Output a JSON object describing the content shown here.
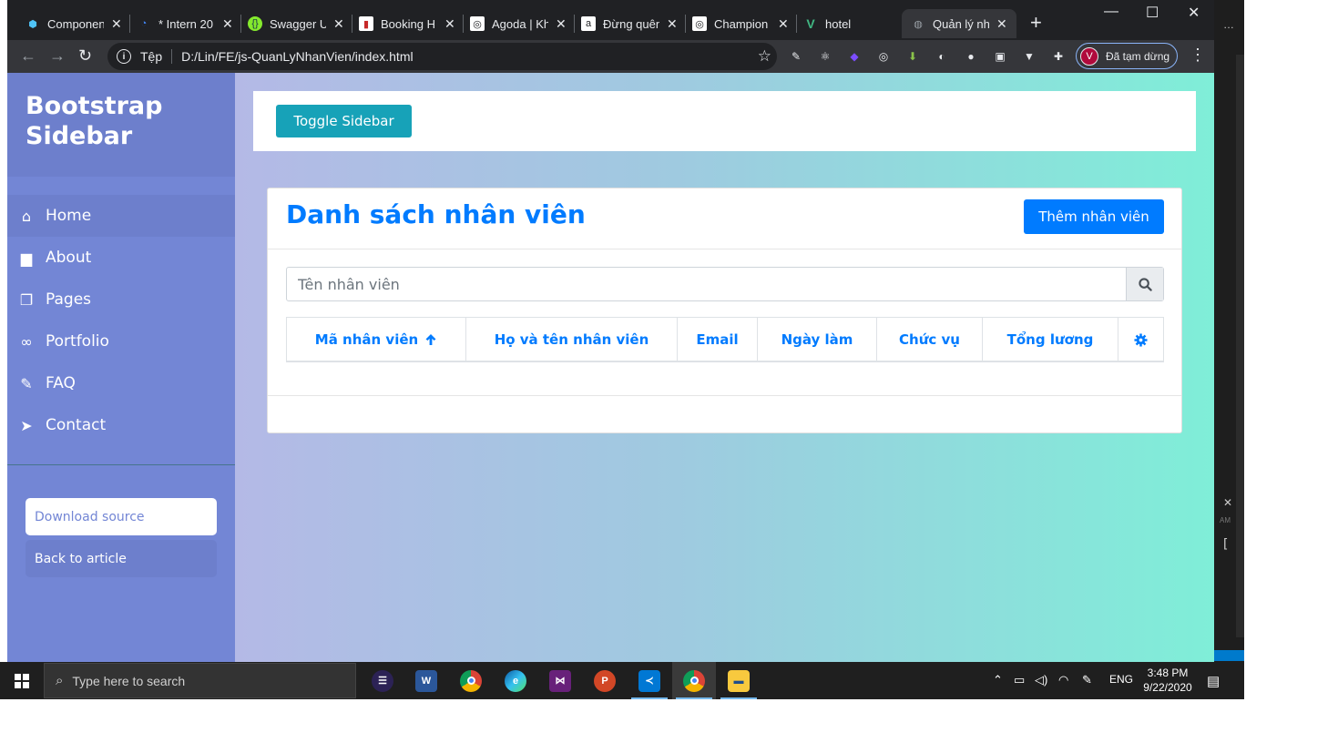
{
  "browser": {
    "tabs": [
      {
        "title": "Componen",
        "favicon": "cube-icon",
        "color": "#1a73e8"
      },
      {
        "title": "* Intern 20",
        "favicon": "clock-icon",
        "color": "#4285f4"
      },
      {
        "title": "Swagger U",
        "favicon": "swagger-icon",
        "color": "#85ea2d"
      },
      {
        "title": "Booking H",
        "favicon": "booking-icon",
        "color": "#c62828"
      },
      {
        "title": "Agoda | Kh",
        "favicon": "agoda-icon",
        "color": "#ffffff"
      },
      {
        "title": "Đừng quên",
        "favicon": "amazon-icon",
        "color": "#ffffff"
      },
      {
        "title": "Champion",
        "favicon": "champion-icon",
        "color": "#ffffff"
      },
      {
        "title": "hotel",
        "favicon": "vue-icon",
        "color": "#41b883"
      },
      {
        "title": "Quản lý nh",
        "favicon": "globe-icon",
        "color": "#9aa0a6",
        "active": true
      }
    ],
    "address_label": "Tệp",
    "url": "D:/Lin/FE/js-QuanLyNhanVien/index.html",
    "profile_initial": "V",
    "profile_status": "Đã tạm dừng"
  },
  "sidebar": {
    "title_line1": "Bootstrap",
    "title_line2": "Sidebar",
    "items": [
      {
        "label": "Home",
        "icon": "home-icon",
        "active": true
      },
      {
        "label": "About",
        "icon": "briefcase-icon"
      },
      {
        "label": "Pages",
        "icon": "copy-icon"
      },
      {
        "label": "Portfolio",
        "icon": "link-icon"
      },
      {
        "label": "FAQ",
        "icon": "paperclip-icon"
      },
      {
        "label": "Contact",
        "icon": "paper-plane-icon"
      }
    ],
    "download_label": "Download source",
    "back_label": "Back to article"
  },
  "content": {
    "toggle_label": "Toggle Sidebar",
    "card_title": "Danh sách nhân viên",
    "add_button_label": "Thêm nhân viên",
    "search_placeholder": "Tên nhân viên",
    "table_headers": [
      "Mã nhân viên",
      "Họ và tên nhân viên",
      "Email",
      "Ngày làm",
      "Chức vụ",
      "Tổng lương"
    ],
    "sort_icon": "arrow-up-icon",
    "settings_icon": "gear-icon"
  },
  "taskbar": {
    "search_placeholder": "Type here to search",
    "language": "ENG",
    "time": "3:48 PM",
    "date": "9/22/2020"
  },
  "colors": {
    "sidebar_bg": "#7386d5",
    "primary": "#007bff",
    "toggle": "#17a2b8"
  }
}
